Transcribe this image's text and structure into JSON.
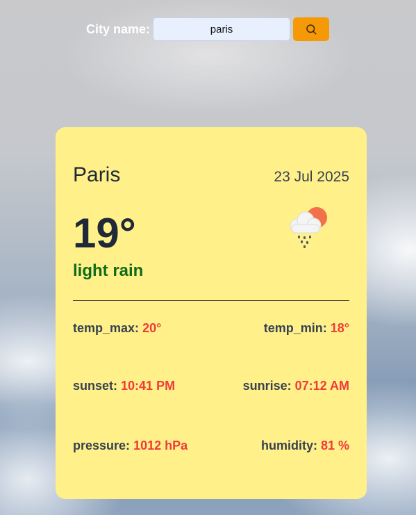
{
  "search": {
    "label": "City name:",
    "value": "paris",
    "button_icon": "search-icon"
  },
  "card": {
    "city": "Paris",
    "date": "23 Jul 2025",
    "temperature": "19°",
    "description": "light rain",
    "weather_icon": "rain-cloud-sun-icon",
    "stats": [
      {
        "label": "temp_max:",
        "value": "20°"
      },
      {
        "label": "temp_min:",
        "value": "18°"
      },
      {
        "label": "sunset:",
        "value": "10:41 PM"
      },
      {
        "label": "sunrise:",
        "value": "07:12 AM"
      },
      {
        "label": "pressure:",
        "value": "1012 hPa"
      },
      {
        "label": "humidity:",
        "value": "81 %"
      }
    ]
  },
  "colors": {
    "card_background": "#fff08a",
    "search_button": "#f59a06",
    "stat_value": "#ef3b3b",
    "description": "#0f6b1a"
  }
}
